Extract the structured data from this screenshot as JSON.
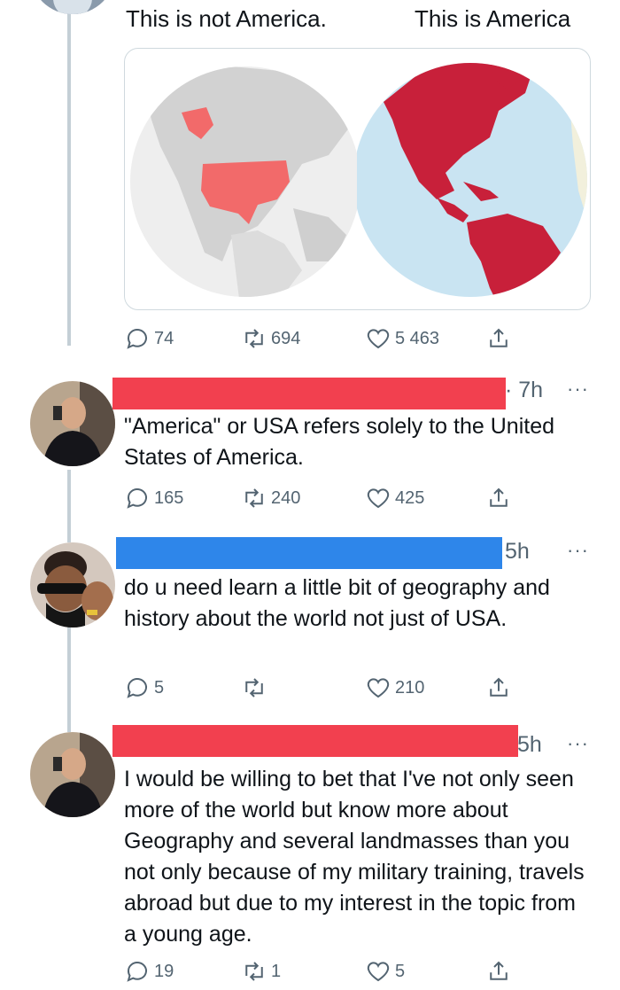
{
  "map_captions": {
    "left": "This is not America.",
    "right": "This is America"
  },
  "tweets": [
    {
      "time": "",
      "text": "",
      "stats": {
        "replies": "74",
        "retweets": "694",
        "likes": "5 463"
      }
    },
    {
      "time": "· 7h",
      "text": "\"America\" or USA refers solely to the United States of America.",
      "redaction_color": "#f2404f",
      "stats": {
        "replies": "165",
        "retweets": "240",
        "likes": "425"
      }
    },
    {
      "time": "5h",
      "text": "do u need learn a little bit of geography and history about the world not just of USA.",
      "redaction_color": "#2e86ea",
      "stats": {
        "replies": "5",
        "retweets": "",
        "likes": "210"
      }
    },
    {
      "time": "5h",
      "text": "I would be willing to bet that I've not only seen more of the world but know more about Geography and several landmasses than you not only because of my military training, travels abroad but due to my interest in the topic from a young age.",
      "redaction_color": "#f2404f",
      "stats": {
        "replies": "19",
        "retweets": "1",
        "likes": "5"
      }
    }
  ],
  "icons": {
    "reply": "reply-icon",
    "retweet": "retweet-icon",
    "like": "heart-icon",
    "share": "share-icon",
    "more": "more-icon"
  },
  "colors": {
    "secondary_text": "#536471",
    "usa_highlight": "#f26a6a",
    "americas_highlight": "#c8203a",
    "ocean": "#c9e4f2"
  }
}
